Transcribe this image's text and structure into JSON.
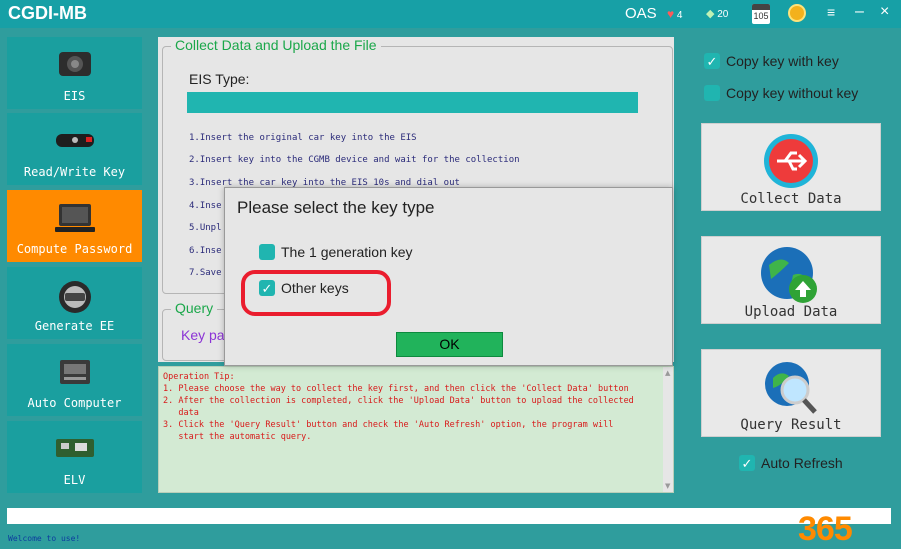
{
  "app": {
    "title": "CGDI-MB"
  },
  "titlebar": {
    "oas": "OAS",
    "hearts": "4",
    "gems": "20",
    "calendar": "105",
    "menu_icon": "hamburger-icon",
    "minimize": "–",
    "close": "×"
  },
  "sidebar": {
    "items": [
      {
        "label": "EIS",
        "icon": "eis-module-icon",
        "active": false
      },
      {
        "label": "Read/Write Key",
        "icon": "car-key-icon",
        "active": false
      },
      {
        "label": "Compute Password",
        "icon": "laptop-icon",
        "active": true
      },
      {
        "label": "Generate EE",
        "icon": "steering-wheel-icon",
        "active": false
      },
      {
        "label": "Auto Computer",
        "icon": "ecu-module-icon",
        "active": false
      },
      {
        "label": "ELV",
        "icon": "circuit-board-icon",
        "active": false
      }
    ]
  },
  "main": {
    "group_title": "Collect Data and Upload the File",
    "eis_type_label": "EIS Type:",
    "steps": [
      "1.Insert the original car key into the EIS",
      "2.Insert key into the CGMB device and wait for the collection",
      "3.Insert the car key into the EIS 10s and dial out",
      "4.Inse",
      "5.Unpl",
      "6.Inse",
      "7.Save"
    ],
    "query_group_title": "Query",
    "key_pa_label": "Key pa"
  },
  "tips": {
    "lines": [
      "Operation Tip:",
      "1. Please choose the way to collect the key first, and then click the 'Collect Data' button",
      "2. After the collection is completed, click the 'Upload Data' button to upload the collected",
      "   data",
      "3. Click the 'Query Result' button and check the 'Auto Refresh' option, the program will",
      "   start the automatic query."
    ]
  },
  "right": {
    "copy_with_key": {
      "label": "Copy key with key",
      "checked": true
    },
    "copy_without_key": {
      "label": "Copy key without key",
      "checked": false
    },
    "collect_button": "Collect Data",
    "upload_button": "Upload  Data",
    "query_button": "Query Result",
    "auto_refresh": {
      "label": "Auto Refresh",
      "checked": true
    }
  },
  "dialog": {
    "title": "Please select the key type",
    "option1": {
      "label": "The 1 generation key",
      "checked": false
    },
    "option2": {
      "label": "Other keys",
      "checked": true
    },
    "ok": "OK"
  },
  "status": {
    "text": "Welcome to use!"
  },
  "watermark": {
    "text": "365"
  },
  "colors": {
    "teal": "#17a0a6",
    "active_orange": "#ff8a00",
    "green_button": "#21b35b",
    "highlight_red": "#ea1d2e",
    "tip_text": "#d81a1a"
  }
}
